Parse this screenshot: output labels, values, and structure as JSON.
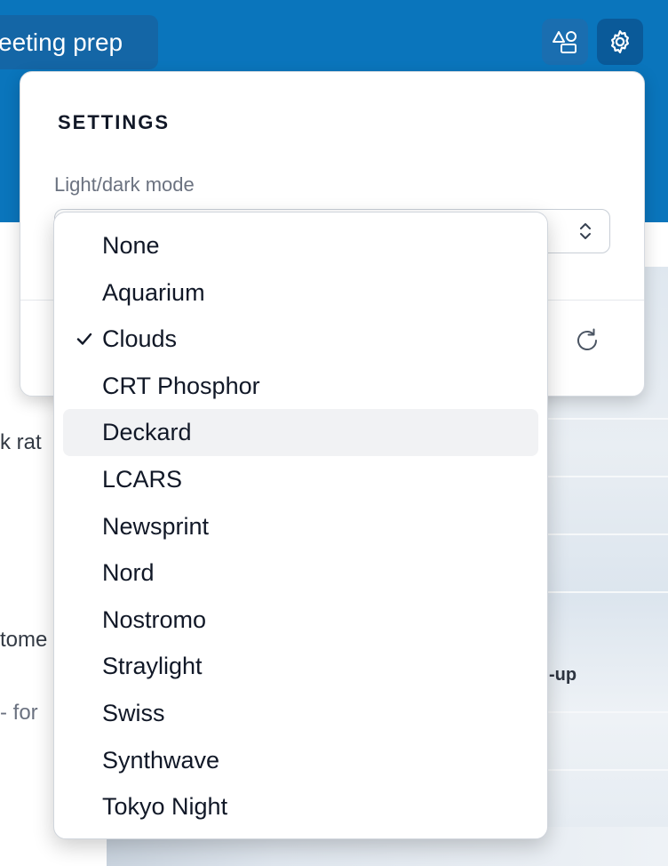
{
  "header": {
    "title": "eeting prep",
    "shapes_icon": "shapes-icon",
    "settings_icon": "gear-icon",
    "accent_color": "#0a75bc"
  },
  "background": {
    "fragments": [
      "k rat",
      "tome",
      "- for",
      "-up"
    ]
  },
  "settings": {
    "title": "SETTINGS",
    "mode_label": "Light/dark mode",
    "reset_icon": "refresh-icon"
  },
  "theme_dropdown": {
    "selected": "Clouds",
    "hovered": "Deckard",
    "options": [
      "None",
      "Aquarium",
      "Clouds",
      "CRT Phosphor",
      "Deckard",
      "LCARS",
      "Newsprint",
      "Nord",
      "Nostromo",
      "Straylight",
      "Swiss",
      "Synthwave",
      "Tokyo Night"
    ]
  }
}
